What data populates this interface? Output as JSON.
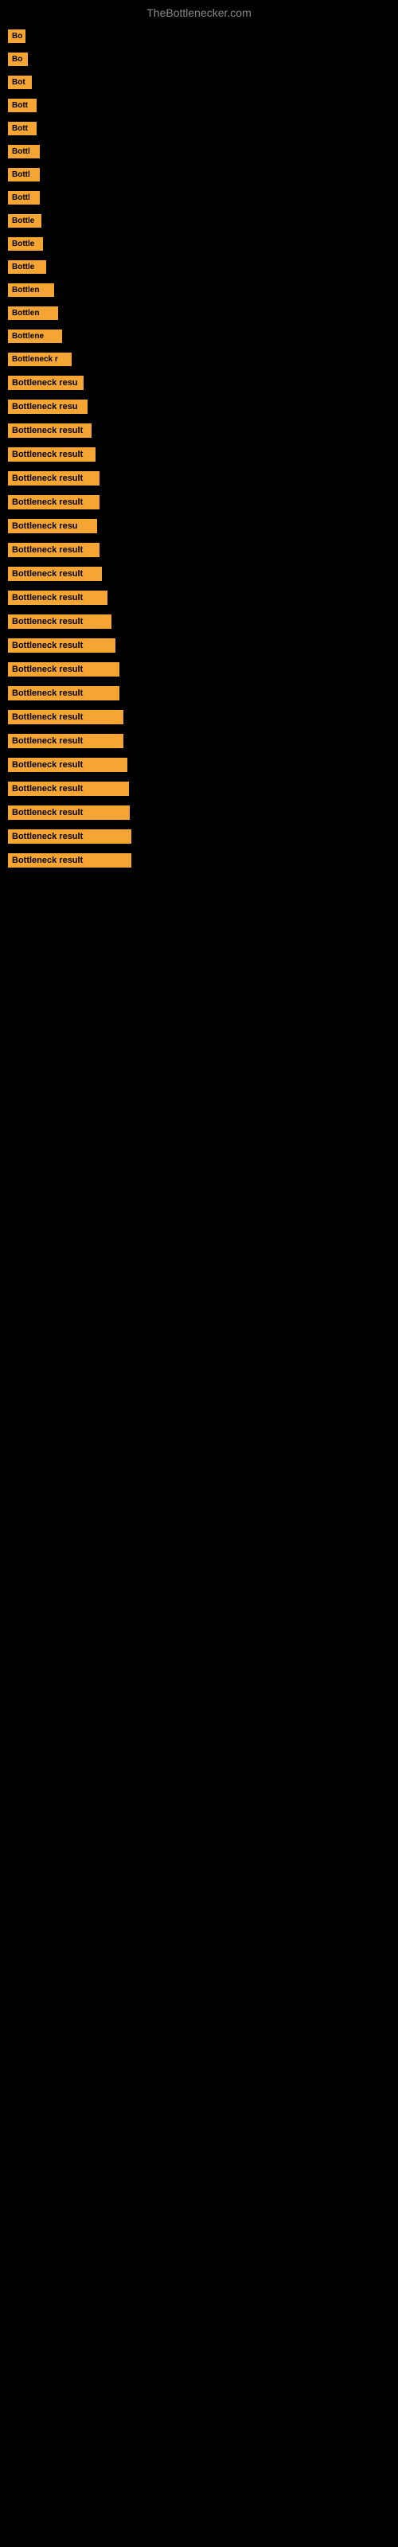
{
  "site": {
    "title": "TheBottlenecker.com"
  },
  "items": [
    {
      "id": 1,
      "label": "Bo"
    },
    {
      "id": 2,
      "label": "Bo"
    },
    {
      "id": 3,
      "label": "Bot"
    },
    {
      "id": 4,
      "label": "Bott"
    },
    {
      "id": 5,
      "label": "Bott"
    },
    {
      "id": 6,
      "label": "Bottl"
    },
    {
      "id": 7,
      "label": "Bottl"
    },
    {
      "id": 8,
      "label": "Bottl"
    },
    {
      "id": 9,
      "label": "Bottle"
    },
    {
      "id": 10,
      "label": "Bottle"
    },
    {
      "id": 11,
      "label": "Bottle"
    },
    {
      "id": 12,
      "label": "Bottlen"
    },
    {
      "id": 13,
      "label": "Bottlen"
    },
    {
      "id": 14,
      "label": "Bottlene"
    },
    {
      "id": 15,
      "label": "Bottleneck r"
    },
    {
      "id": 16,
      "label": "Bottleneck resu"
    },
    {
      "id": 17,
      "label": "Bottleneck resu"
    },
    {
      "id": 18,
      "label": "Bottleneck result"
    },
    {
      "id": 19,
      "label": "Bottleneck result"
    },
    {
      "id": 20,
      "label": "Bottleneck result"
    },
    {
      "id": 21,
      "label": "Bottleneck result"
    },
    {
      "id": 22,
      "label": "Bottleneck resu"
    },
    {
      "id": 23,
      "label": "Bottleneck result"
    },
    {
      "id": 24,
      "label": "Bottleneck result"
    },
    {
      "id": 25,
      "label": "Bottleneck result"
    },
    {
      "id": 26,
      "label": "Bottleneck result"
    },
    {
      "id": 27,
      "label": "Bottleneck result"
    },
    {
      "id": 28,
      "label": "Bottleneck result"
    },
    {
      "id": 29,
      "label": "Bottleneck result"
    },
    {
      "id": 30,
      "label": "Bottleneck result"
    },
    {
      "id": 31,
      "label": "Bottleneck result"
    },
    {
      "id": 32,
      "label": "Bottleneck result"
    },
    {
      "id": 33,
      "label": "Bottleneck result"
    },
    {
      "id": 34,
      "label": "Bottleneck result"
    },
    {
      "id": 35,
      "label": "Bottleneck result"
    },
    {
      "id": 36,
      "label": "Bottleneck result"
    }
  ]
}
